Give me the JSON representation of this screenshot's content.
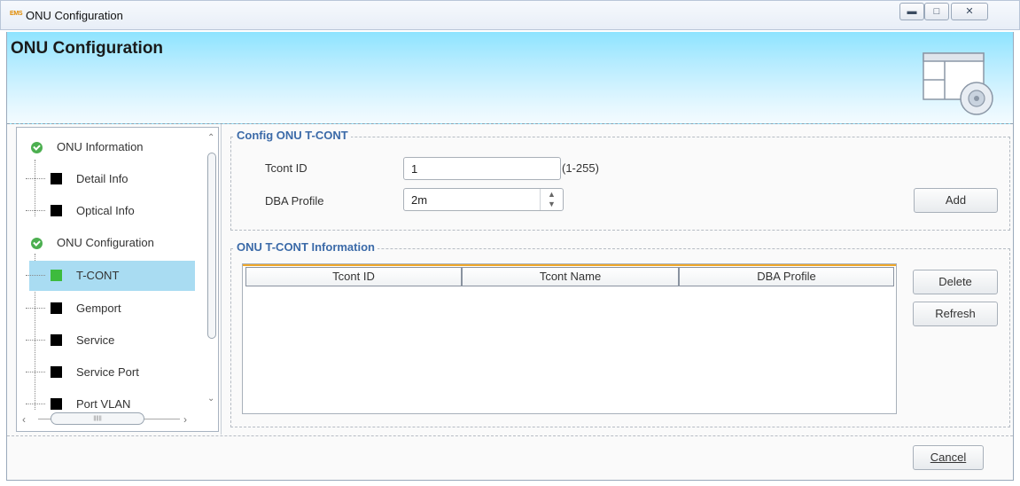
{
  "window": {
    "app_icon": "EMS",
    "title": "ONU Configuration",
    "controls": [
      "minimize-icon",
      "maximize-icon",
      "close-icon"
    ]
  },
  "header": {
    "title": "ONU Configuration",
    "icon": "config-window-icon"
  },
  "tree": {
    "items": [
      {
        "label": "ONU Information",
        "type": "group",
        "icon": "expand-icon"
      },
      {
        "label": "Detail Info",
        "type": "leaf"
      },
      {
        "label": "Optical Info",
        "type": "leaf"
      },
      {
        "label": "ONU Configuration",
        "type": "group",
        "icon": "expand-icon"
      },
      {
        "label": "T-CONT",
        "type": "leaf",
        "selected": true
      },
      {
        "label": "Gemport",
        "type": "leaf"
      },
      {
        "label": "Service",
        "type": "leaf"
      },
      {
        "label": "Service Port",
        "type": "leaf"
      },
      {
        "label": "Port VLAN",
        "type": "leaf"
      }
    ],
    "selected_color": "#a9dcf2",
    "selected_marker_color": "#3dbb3d"
  },
  "config_group": {
    "title": "Config ONU T-CONT",
    "tcont_id_label": "Tcont ID",
    "tcont_id_value": "1",
    "tcont_id_hint": "(1-255)",
    "dba_profile_label": "DBA Profile",
    "dba_profile_value": "2m",
    "add_button": "Add"
  },
  "info_group": {
    "title": "ONU T-CONT Information",
    "columns": [
      "Tcont ID",
      "Tcont Name",
      "DBA Profile"
    ],
    "rows": [],
    "delete_button": "Delete",
    "refresh_button": "Refresh"
  },
  "footer": {
    "cancel_button": "Cancel"
  },
  "colors": {
    "header_gradient_top": "#8ee4ff",
    "group_title": "#3b6aa8",
    "table_accent": "#f0a82a"
  }
}
